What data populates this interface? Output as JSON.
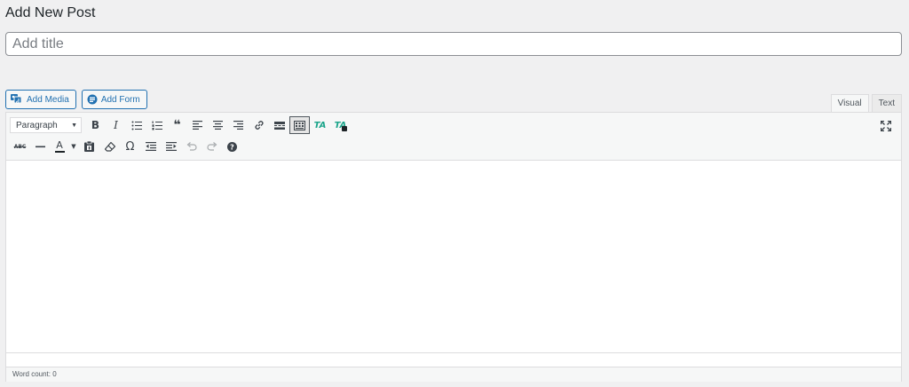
{
  "page": {
    "title": "Add New Post"
  },
  "title_field": {
    "placeholder": "Add title",
    "value": ""
  },
  "media_buttons": {
    "add_media": "Add Media",
    "add_form": "Add Form"
  },
  "editor_tabs": {
    "visual": "Visual",
    "text": "Text",
    "active": "visual"
  },
  "toolbar": {
    "format_select": "Paragraph",
    "row1_icons": [
      "bold-icon",
      "italic-icon",
      "bullet-list-icon",
      "numbered-list-icon",
      "blockquote-icon",
      "align-left-icon",
      "align-center-icon",
      "align-right-icon",
      "link-icon",
      "read-more-icon",
      "toolbar-toggle-icon",
      "text-ta-icon",
      "text-ta-plus-icon"
    ],
    "row2_icons": [
      "strikethrough-icon",
      "horizontal-line-icon",
      "text-color-icon",
      "paste-text-icon",
      "clear-formatting-icon",
      "special-character-icon",
      "outdent-icon",
      "indent-icon",
      "undo-icon",
      "redo-icon",
      "help-icon"
    ],
    "bold": "B",
    "italic": "I",
    "text_color": "A",
    "omega": "Ω",
    "abc": "ABC",
    "ta": "TA"
  },
  "status": {
    "word_count": "Word count: 0"
  },
  "colors": {
    "accent": "#2271b1",
    "ta_green": "#1aa48a",
    "background": "#f0f0f1"
  }
}
